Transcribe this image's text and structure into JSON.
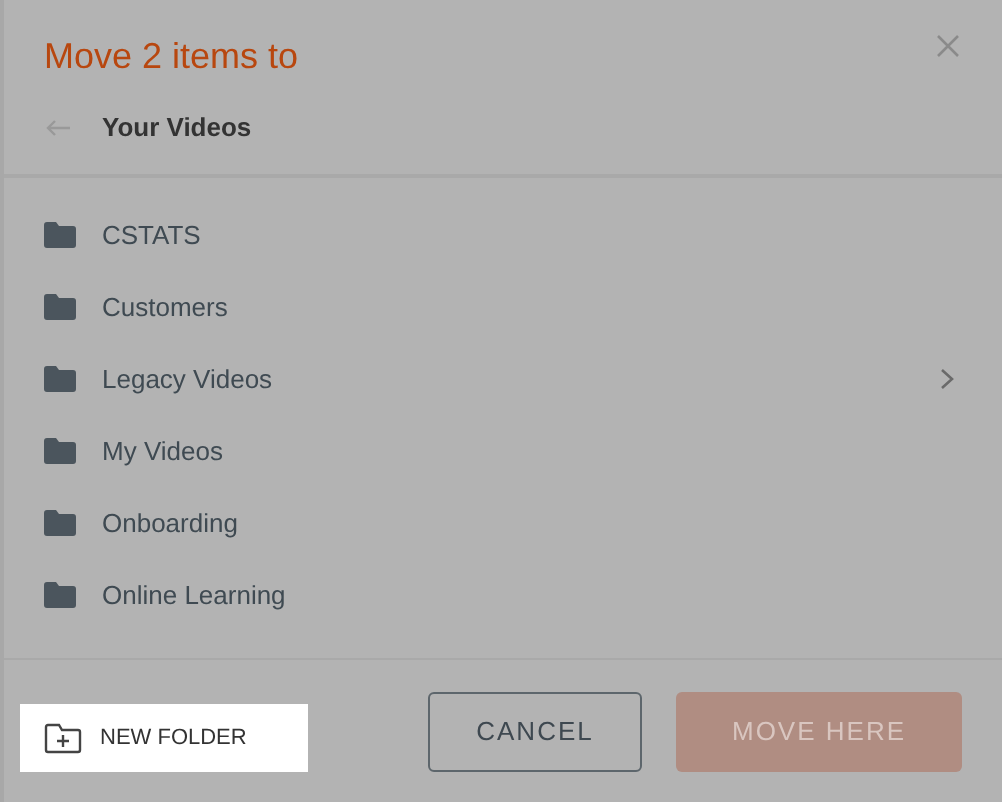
{
  "dialog": {
    "title": "Move 2 items to"
  },
  "breadcrumb": {
    "location": "Your Videos"
  },
  "folders": [
    {
      "name": "CSTATS",
      "has_children": false
    },
    {
      "name": "Customers",
      "has_children": false
    },
    {
      "name": "Legacy Videos",
      "has_children": true
    },
    {
      "name": "My Videos",
      "has_children": false
    },
    {
      "name": "Onboarding",
      "has_children": false
    },
    {
      "name": "Online Learning",
      "has_children": false
    }
  ],
  "new_folder": {
    "label": "NEW FOLDER",
    "highlighted": true
  },
  "buttons": [
    {
      "kind": "secondary",
      "label": "CANCEL",
      "disabled": false
    },
    {
      "kind": "primary",
      "label": "MOVE HERE",
      "disabled": true
    }
  ]
}
